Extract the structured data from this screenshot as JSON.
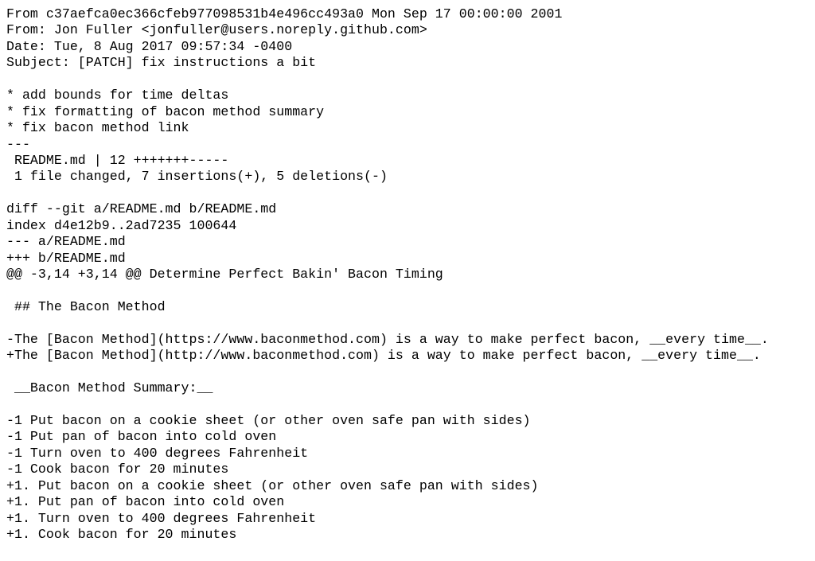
{
  "document": {
    "kind": "git-format-patch-email",
    "background_color": "#ffffff",
    "text_color": "#000000",
    "headers": {
      "from_commit": "From c37aefca0ec366cfeb977098531b4e496cc493a0 Mon Sep 17 00:00:00 2001",
      "from_author": "From: Jon Fuller <jonfuller@users.noreply.github.com>",
      "date": "Date: Tue, 8 Aug 2017 09:57:34 -0400",
      "subject": "Subject: [PATCH] fix instructions a bit"
    },
    "commit_message": [
      "* add bounds for time deltas",
      "* fix formatting of bacon method summary",
      "* fix bacon method link"
    ],
    "separator": "---",
    "diffstat": {
      "file_line": " README.md | 12 +++++++-----",
      "summary_line": " 1 file changed, 7 insertions(+), 5 deletions(-)"
    },
    "diff_header": {
      "diff_git": "diff --git a/README.md b/README.md",
      "index": "index d4e12b9..2ad7235 100644",
      "old_file": "--- a/README.md",
      "new_file": "+++ b/README.md",
      "hunk": "@@ -3,14 +3,14 @@ Determine Perfect Bakin' Bacon Timing"
    },
    "lines": [
      {
        "id": "line-from-commit",
        "text": "From c37aefca0ec366cfeb977098531b4e496cc493a0 Mon Sep 17 00:00:00 2001",
        "type": "header"
      },
      {
        "id": "line-from-author",
        "text": "From: Jon Fuller <jonfuller@users.noreply.github.com>",
        "type": "header"
      },
      {
        "id": "line-date",
        "text": "Date: Tue, 8 Aug 2017 09:57:34 -0400",
        "type": "header"
      },
      {
        "id": "line-subject",
        "text": "Subject: [PATCH] fix instructions a bit",
        "type": "header"
      },
      {
        "id": "line-blank-1",
        "text": "",
        "type": "blank"
      },
      {
        "id": "line-msg-1",
        "text": "* add bounds for time deltas",
        "type": "message"
      },
      {
        "id": "line-msg-2",
        "text": "* fix formatting of bacon method summary",
        "type": "message"
      },
      {
        "id": "line-msg-3",
        "text": "* fix bacon method link",
        "type": "message"
      },
      {
        "id": "line-separator",
        "text": "---",
        "type": "separator"
      },
      {
        "id": "line-diffstat-file",
        "text": " README.md | 12 +++++++-----",
        "type": "diffstat"
      },
      {
        "id": "line-diffstat-summary",
        "text": " 1 file changed, 7 insertions(+), 5 deletions(-)",
        "type": "diffstat"
      },
      {
        "id": "line-blank-2",
        "text": "",
        "type": "blank"
      },
      {
        "id": "line-diff-git",
        "text": "diff --git a/README.md b/README.md",
        "type": "diff-header"
      },
      {
        "id": "line-index",
        "text": "index d4e12b9..2ad7235 100644",
        "type": "diff-header"
      },
      {
        "id": "line-old-file",
        "text": "--- a/README.md",
        "type": "diff-header"
      },
      {
        "id": "line-new-file",
        "text": "+++ b/README.md",
        "type": "diff-header"
      },
      {
        "id": "line-hunk",
        "text": "@@ -3,14 +3,14 @@ Determine Perfect Bakin' Bacon Timing",
        "type": "hunk"
      },
      {
        "id": "line-blank-3",
        "text": "",
        "type": "blank"
      },
      {
        "id": "line-context-heading",
        "text": " ## The Bacon Method",
        "type": "context"
      },
      {
        "id": "line-blank-4",
        "text": "",
        "type": "blank"
      },
      {
        "id": "line-removed-link",
        "text": "-The [Bacon Method](https://www.baconmethod.com) is a way to make perfect bacon, __every time__.",
        "type": "removed"
      },
      {
        "id": "line-added-link",
        "text": "+The [Bacon Method](http://www.baconmethod.com) is a way to make perfect bacon, __every time__.",
        "type": "added"
      },
      {
        "id": "line-blank-5",
        "text": "",
        "type": "blank"
      },
      {
        "id": "line-context-summary",
        "text": " __Bacon Method Summary:__",
        "type": "context"
      },
      {
        "id": "line-blank-6",
        "text": "",
        "type": "blank"
      },
      {
        "id": "line-removed-step-1",
        "text": "-1 Put bacon on a cookie sheet (or other oven safe pan with sides)",
        "type": "removed"
      },
      {
        "id": "line-removed-step-2",
        "text": "-1 Put pan of bacon into cold oven",
        "type": "removed"
      },
      {
        "id": "line-removed-step-3",
        "text": "-1 Turn oven to 400 degrees Fahrenheit",
        "type": "removed"
      },
      {
        "id": "line-removed-step-4",
        "text": "-1 Cook bacon for 20 minutes",
        "type": "removed"
      },
      {
        "id": "line-added-step-1",
        "text": "+1. Put bacon on a cookie sheet (or other oven safe pan with sides)",
        "type": "added"
      },
      {
        "id": "line-added-step-2",
        "text": "+1. Put pan of bacon into cold oven",
        "type": "added"
      },
      {
        "id": "line-added-step-3",
        "text": "+1. Turn oven to 400 degrees Fahrenheit",
        "type": "added"
      },
      {
        "id": "line-added-step-4",
        "text": "+1. Cook bacon for 20 minutes",
        "type": "added"
      }
    ]
  }
}
